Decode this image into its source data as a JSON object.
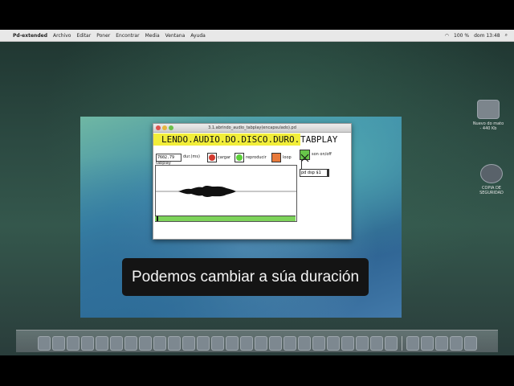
{
  "menubar": {
    "app_name": "Pd-extended",
    "items": [
      "Archivo",
      "Editar",
      "Poner",
      "Encontrar",
      "Media",
      "Ventana",
      "Ayuda"
    ],
    "clock": "dom 13:48",
    "battery": "100 %"
  },
  "desktop_icons": [
    {
      "label": "Nuevo do mato - 440 Kb",
      "icon": "folder-icon"
    },
    {
      "label": "COPIA DE SEGURIDAD",
      "icon": "time-machine-icon"
    }
  ],
  "pd_window": {
    "title": "3.1.abrindo_audio_tabplay(encapsulado).pd",
    "banner": "LENDO.AUDIO.DO.DISCO.DURO.",
    "banner_tail": "TABPLAY",
    "duration_value": "7602.79",
    "duration_label": "dur.(ms)",
    "tabplay_label": "tabplay",
    "load_label": "cargar",
    "play_label": "reproducir",
    "loop_label": "loop",
    "sound_toggle_label": "son on/off",
    "dsp_message": "pd dsp $1",
    "progress": 0.01
  },
  "subtitle": "Podemos cambiar a súa duración",
  "colors": {
    "banner": "#f2ee3a",
    "bang_load": "#d33a2f",
    "bang_play": "#5cd03a",
    "bang_loop": "#e87a3b",
    "toggle": "#68c64a"
  },
  "dock_apps_count": 30
}
